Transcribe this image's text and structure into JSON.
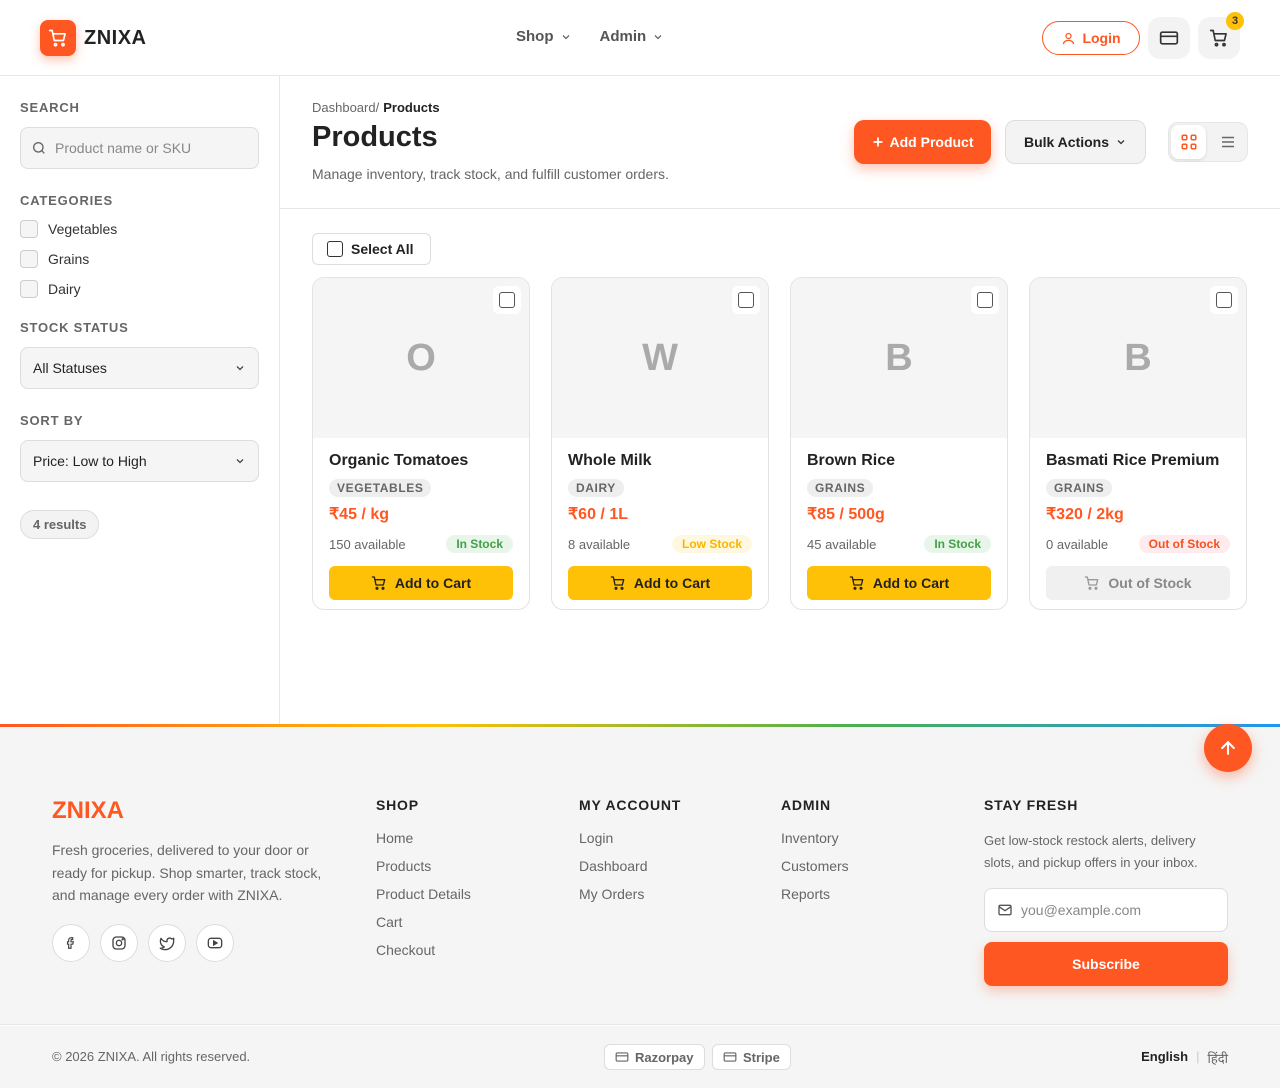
{
  "header": {
    "brand": "ZNIXA",
    "nav": [
      {
        "label": "Shop"
      },
      {
        "label": "Admin"
      }
    ],
    "login_label": "Login",
    "cart_count": "3"
  },
  "sidebar": {
    "search_label": "SEARCH",
    "search_placeholder": "Product name or SKU",
    "categories_label": "CATEGORIES",
    "categories": [
      "Vegetables",
      "Grains",
      "Dairy"
    ],
    "stock_label": "STOCK STATUS",
    "stock_value": "All Statuses",
    "sort_label": "SORT BY",
    "sort_value": "Price: Low to High",
    "results": "4 results"
  },
  "page": {
    "breadcrumb_root": "Dashboard",
    "breadcrumb_sep": "/",
    "breadcrumb_current": "Products",
    "title": "Products",
    "subtitle": "Manage inventory, track stock, and fulfill customer orders.",
    "add_label": "Add Product",
    "bulk_label": "Bulk Actions",
    "select_all_label": "Select All"
  },
  "products": [
    {
      "initial": "O",
      "name": "Organic Tomatoes",
      "category": "VEGETABLES",
      "price": "₹45 / kg",
      "available": "150 available",
      "status": "In Stock",
      "button": "Add to Cart",
      "in_stock": true
    },
    {
      "initial": "W",
      "name": "Whole Milk",
      "category": "DAIRY",
      "price": "₹60 / 1L",
      "available": "8 available",
      "status": "Low Stock",
      "button": "Add to Cart",
      "in_stock": true
    },
    {
      "initial": "B",
      "name": "Brown Rice",
      "category": "GRAINS",
      "price": "₹85 / 500g",
      "available": "45 available",
      "status": "In Stock",
      "button": "Add to Cart",
      "in_stock": true
    },
    {
      "initial": "B",
      "name": "Basmati Rice Premium",
      "category": "GRAINS",
      "price": "₹320 / 2kg",
      "available": "0 available",
      "status": "Out of Stock",
      "button": "Out of Stock",
      "in_stock": false
    }
  ],
  "status_colors": {
    "In Stock": {
      "bg": "#e8f5e9",
      "fg": "#43a047"
    },
    "Low Stock": {
      "bg": "#fff8e1",
      "fg": "#f9b400"
    },
    "Out of Stock": {
      "bg": "#ffebee",
      "fg": "#f4511e"
    }
  },
  "footer": {
    "brand": "ZNIXA",
    "description": "Fresh groceries, delivered to your door or ready for pickup. Shop smarter, track stock, and manage every order with ZNIXA.",
    "socials": [
      "facebook-icon",
      "instagram-icon",
      "twitter-icon",
      "youtube-icon"
    ],
    "shop_title": "SHOP",
    "shop_links": [
      "Home",
      "Products",
      "Product Details",
      "Cart",
      "Checkout"
    ],
    "account_title": "MY ACCOUNT",
    "account_links": [
      "Login",
      "Dashboard",
      "My Orders"
    ],
    "admin_title": "ADMIN",
    "admin_links": [
      "Inventory",
      "Customers",
      "Reports"
    ],
    "fresh_title": "STAY FRESH",
    "fresh_desc": "Get low-stock restock alerts, delivery slots, and pickup offers in your inbox.",
    "email_placeholder": "you@example.com",
    "subscribe_label": "Subscribe"
  },
  "bottom": {
    "copyright": "© 2026 ZNIXA. All rights reserved.",
    "payments": [
      "Razorpay",
      "Stripe"
    ],
    "lang_active": "English",
    "lang_other": "हिंदी"
  },
  "colors": {
    "accent": "#ff5722",
    "cart_yellow": "#ffc107"
  }
}
